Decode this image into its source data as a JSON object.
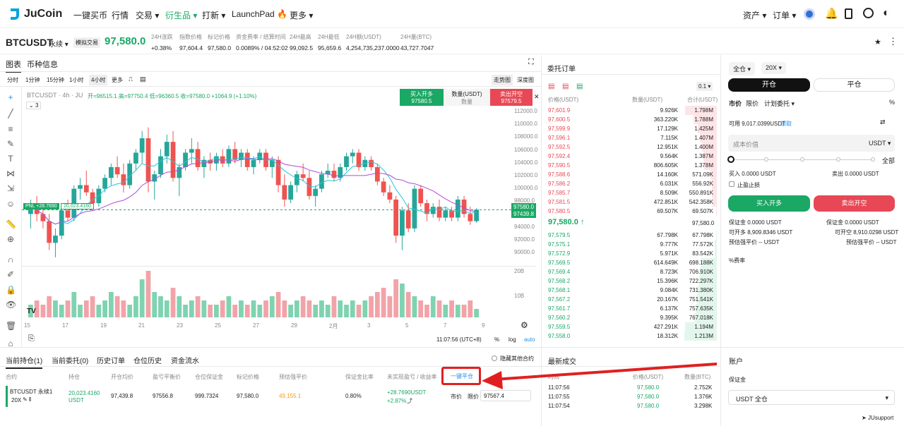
{
  "nav": {
    "brand": "JuCoin",
    "items": [
      "一键买币",
      "行情",
      "交易 ▾",
      "衍生品 ▾",
      "打新 ▾",
      "LaunchPad 🔥",
      "更多 ▾"
    ],
    "right": [
      "资产 ▾",
      "订单 ▾"
    ]
  },
  "ticker": {
    "symbol": "BTCUSDT",
    "type": "永续 ▾",
    "badge": "模拟交易",
    "price": "97,580.0",
    "stats": [
      {
        "l": "24H涨跌",
        "v": "+0.38%"
      },
      {
        "l": "指数价格",
        "v": "97,604.4"
      },
      {
        "l": "标记价格",
        "v": "97,580.0"
      },
      {
        "l": "资金费率 / 结算时间",
        "v": "0.0089% / 04:52:02"
      },
      {
        "l": "24H最高",
        "v": "99,092.5"
      },
      {
        "l": "24H最低",
        "v": "95,659.6"
      },
      {
        "l": "24H额(USDT)",
        "v": "4,254,735,237.0000"
      },
      {
        "l": "24H量(BTC)",
        "v": "43,727.7047"
      }
    ]
  },
  "chart": {
    "tabs": [
      "图表",
      "币种信息"
    ],
    "intervals": [
      "分时",
      "1分钟",
      "15分钟",
      "1小时",
      "4小时",
      "更多"
    ],
    "views": [
      "走势图",
      "深度图"
    ],
    "legend": "BTCUSDT · 4h · JU",
    "ohlc": "开=96515.1 高=97750.4 低=96360.5 收=97580.0 +1064.9 (+1.10%)",
    "ind": "3",
    "buy_label": "买入开多",
    "buy_price": "97580.5",
    "qty_label": "数量(USDT)",
    "qty_ph": "数量",
    "sell_label": "卖出开空",
    "sell_price": "97579.5",
    "pnl": "PNL +28.7690",
    "pnl_qty": "20,023.4160",
    "price_tag": "97580.0",
    "price_tag2": "97439.8",
    "y_ticks": [
      "112000.0",
      "110000.0",
      "108000.0",
      "106000.0",
      "104000.0",
      "102000.0",
      "100000.0",
      "98000.0",
      "96000.0",
      "94000.0",
      "92000.0",
      "90000.0"
    ],
    "vol_ticks": [
      "20B",
      "10B"
    ],
    "x_ticks": [
      "15",
      "17",
      "19",
      "21",
      "23",
      "25",
      "27",
      "29",
      "2月",
      "3",
      "5",
      "7",
      "9"
    ],
    "time": "11:07:56 (UTC+8)",
    "log": "log",
    "auto": "auto"
  },
  "orderbook": {
    "title": "委托订单",
    "precision": "0.1 ▾",
    "headers": [
      "价格(USDT)",
      "数量(USDT)",
      "合计(USDT)"
    ],
    "asks": [
      [
        "97,601.9",
        "9.926K",
        "1.798M"
      ],
      [
        "97,600.5",
        "363.220K",
        "1.788M"
      ],
      [
        "97,599.9",
        "17.129K",
        "1.425M"
      ],
      [
        "97,596.1",
        "7.115K",
        "1.407M"
      ],
      [
        "97,592.5",
        "12.951K",
        "1.400M"
      ],
      [
        "97,592.4",
        "9.564K",
        "1.387M"
      ],
      [
        "97,590.5",
        "806.605K",
        "1.378M"
      ],
      [
        "97,588.6",
        "14.160K",
        "571.09K"
      ],
      [
        "97,586.2",
        "6.031K",
        "556.92K"
      ],
      [
        "97,585.7",
        "8.509K",
        "550.891K"
      ],
      [
        "97,581.5",
        "472.851K",
        "542.358K"
      ],
      [
        "97,580.5",
        "69.507K",
        "69.507K"
      ]
    ],
    "mid": "97,580.0 ↑",
    "mid_right": "97,580.0",
    "bids": [
      [
        "97,579.5",
        "67.798K",
        "67.798K"
      ],
      [
        "97,575.1",
        "9.777K",
        "77.572K"
      ],
      [
        "97,572.9",
        "5.971K",
        "83.542K"
      ],
      [
        "97,569.5",
        "614.649K",
        "698.188K"
      ],
      [
        "97,569.4",
        "8.723K",
        "706.910K"
      ],
      [
        "97,568.2",
        "15.396K",
        "722.297K"
      ],
      [
        "97,568.1",
        "9.084K",
        "731.380K"
      ],
      [
        "97,567.2",
        "20.167K",
        "751.541K"
      ],
      [
        "97,561.7",
        "6.137K",
        "757.635K"
      ],
      [
        "97,560.2",
        "9.395K",
        "767.018K"
      ],
      [
        "97,559.5",
        "427.291K",
        "1.194M"
      ],
      [
        "97,558.0",
        "18.312K",
        "1.213M"
      ]
    ]
  },
  "trade": {
    "margin": "全仓 ▾",
    "lev": "20X ▾",
    "open": "开仓",
    "close": "平仓",
    "types": [
      "市价",
      "限价",
      "计划委托 ▾"
    ],
    "avail": "可用 9,017.0399USDT",
    "claim": "领取",
    "cost_ph": "成本价值",
    "unit": "USDT ▾",
    "all": "全部",
    "buy_l": "买入 0.0000 USDT",
    "sell_l": "卖出 0.0000 USDT",
    "tpsl": "止盈止损",
    "buy_btn": "买入开多",
    "sell_btn": "卖出开空",
    "info": [
      [
        "保证金 0.0000 USDT",
        "保证金 0.0000 USDT"
      ],
      [
        "可开多 8,909.8346  USDT",
        "可开空 8,910.0298  USDT"
      ],
      [
        "预估强平价 --  USDT",
        "预估强平价 --  USDT"
      ]
    ],
    "fee": "%费率",
    "account": "账户",
    "acc_margin": "保证金",
    "acc_sel": "USDT 全仓"
  },
  "positions": {
    "tabs": [
      "当前持仓(1)",
      "当前委托(0)",
      "历史订单",
      "仓位历史",
      "资金流水"
    ],
    "hide": "隐藏其他合约",
    "headers": [
      "合约",
      "持仓",
      "开仓均价",
      "盈亏平衡价",
      "仓位保证金",
      "标记价格",
      "预估强平价",
      "保证金比率",
      "未实现盈亏 / 收益率"
    ],
    "close_all": "一键平仓",
    "row": {
      "sym": "BTCUSDT 永续1",
      "lev": "20X",
      "qty": "20,023.4160",
      "qty_u": "USDT",
      "avg": "97,439.8",
      "be": "97556.8",
      "margin": "999.7324",
      "mark": "97,580.0",
      "liq": "49,155.1",
      "ratio": "0.80%",
      "pnl": "+28.7690USDT",
      "roe": "+2.87%",
      "mkt": "市价",
      "lmt": "限价",
      "price": "97567.4"
    }
  },
  "trades": {
    "title": "最新成交",
    "headers": [
      "时间",
      "价格(USDT)",
      "数量(BTC)"
    ],
    "rows": [
      [
        "11:07:56",
        "97,580.0",
        "2.752K"
      ],
      [
        "11:07:55",
        "97,580.0",
        "1.376K"
      ],
      [
        "11:07:54",
        "97,580.0",
        "3.298K"
      ]
    ]
  },
  "support": "JUsupport",
  "chart_data": {
    "type": "candlestick",
    "ylim": [
      90000,
      112000
    ],
    "candles": [
      [
        97,
        99,
        95,
        98
      ],
      [
        98,
        99.5,
        96,
        97
      ],
      [
        97,
        98.5,
        95,
        96
      ],
      [
        96,
        97,
        92,
        93
      ],
      [
        93,
        95,
        91,
        94
      ],
      [
        94,
        98,
        93.5,
        97.5
      ],
      [
        97.5,
        99,
        96,
        96.5
      ],
      [
        96.5,
        101,
        96,
        100.5
      ],
      [
        100.5,
        102,
        99,
        101
      ],
      [
        101,
        103,
        99.5,
        100
      ],
      [
        100,
        100.5,
        97.5,
        98.5
      ],
      [
        98.5,
        101,
        98,
        100.5
      ],
      [
        100.5,
        102.5,
        100,
        102
      ],
      [
        102,
        104,
        101,
        103.5
      ],
      [
        103.5,
        105,
        102,
        102.5
      ],
      [
        102.5,
        104,
        100,
        101
      ],
      [
        101,
        104.5,
        100.5,
        104
      ],
      [
        104,
        106,
        103,
        105.5
      ],
      [
        105.5,
        108.5,
        104,
        107.5
      ],
      [
        107.5,
        109,
        100,
        101.5
      ],
      [
        101.5,
        103,
        99,
        102.5
      ],
      [
        102.5,
        106,
        102,
        105
      ],
      [
        105,
        108,
        104,
        107
      ],
      [
        107,
        108.5,
        101.5,
        102
      ],
      [
        102,
        104,
        99.5,
        103.5
      ],
      [
        103.5,
        106,
        103,
        105.5
      ],
      [
        105.5,
        107.5,
        104,
        106
      ],
      [
        106,
        107,
        103,
        103.5
      ],
      [
        103.5,
        105,
        102,
        104.5
      ],
      [
        104.5,
        105.5,
        103,
        104
      ],
      [
        104,
        105.5,
        103,
        105
      ],
      [
        105,
        106,
        103.5,
        104
      ],
      [
        104,
        106.5,
        103.5,
        106
      ],
      [
        106,
        107,
        104,
        104.5
      ],
      [
        104.5,
        106,
        103.5,
        105.5
      ],
      [
        105.5,
        106,
        103,
        103.5
      ],
      [
        103.5,
        105,
        102.5,
        104.5
      ],
      [
        104.5,
        106,
        104,
        105.5
      ],
      [
        105.5,
        106,
        103,
        103.5
      ],
      [
        103.5,
        105,
        102,
        104.5
      ],
      [
        104.5,
        105,
        100,
        101
      ],
      [
        101,
        102.5,
        98,
        99
      ],
      [
        99,
        101.5,
        98.5,
        101
      ],
      [
        101,
        103,
        100,
        102.5
      ],
      [
        102.5,
        104,
        101.5,
        102
      ],
      [
        102,
        103,
        99,
        99.5
      ],
      [
        99.5,
        101,
        98,
        100.5
      ],
      [
        100.5,
        103,
        100,
        102.5
      ],
      [
        102.5,
        104,
        102,
        103
      ],
      [
        103,
        104,
        101.5,
        102
      ],
      [
        102,
        104,
        101.5,
        103.5
      ],
      [
        103.5,
        105.5,
        103,
        105
      ],
      [
        105,
        106,
        104,
        105.5
      ],
      [
        105.5,
        106,
        103,
        103.5
      ],
      [
        103.5,
        105,
        103,
        104.5
      ],
      [
        104.5,
        105,
        103,
        103.5
      ],
      [
        103.5,
        104,
        101,
        101.5
      ],
      [
        101.5,
        102,
        99.5,
        100
      ],
      [
        100,
        101,
        98.5,
        99
      ],
      [
        99,
        99.5,
        93,
        94
      ],
      [
        94,
        98,
        92,
        97.5
      ],
      [
        97.5,
        98.5,
        94.5,
        95
      ],
      [
        95,
        101,
        94.5,
        100.5
      ],
      [
        100.5,
        101,
        98,
        98.5
      ],
      [
        98.5,
        99,
        96,
        97
      ],
      [
        97,
        98.5,
        96.5,
        98
      ],
      [
        98,
        99,
        96,
        96.5
      ],
      [
        96.5,
        98,
        96,
        97.5
      ],
      [
        97.5,
        98,
        96,
        96.5
      ],
      [
        96.5,
        99.5,
        96,
        99
      ],
      [
        99,
        99.5,
        96.5,
        97
      ],
      [
        97,
        98,
        95.5,
        96
      ],
      [
        96,
        97.8,
        95.8,
        97.6
      ]
    ],
    "volume": [
      3,
      4,
      3,
      5,
      4,
      3,
      4,
      6,
      3,
      4,
      5,
      3,
      4,
      6,
      5,
      4,
      3,
      5,
      9,
      11,
      6,
      5,
      4,
      7,
      5,
      3,
      4,
      5,
      4,
      3,
      3,
      4,
      5,
      3,
      4,
      3,
      4,
      3,
      4,
      5,
      6,
      4,
      3,
      4,
      5,
      4,
      3,
      4,
      3,
      5,
      4,
      3,
      4,
      3,
      4,
      5,
      6,
      7,
      5,
      9,
      8,
      6,
      5,
      4,
      3,
      5,
      4,
      3,
      4,
      3,
      3,
      4,
      2
    ]
  }
}
